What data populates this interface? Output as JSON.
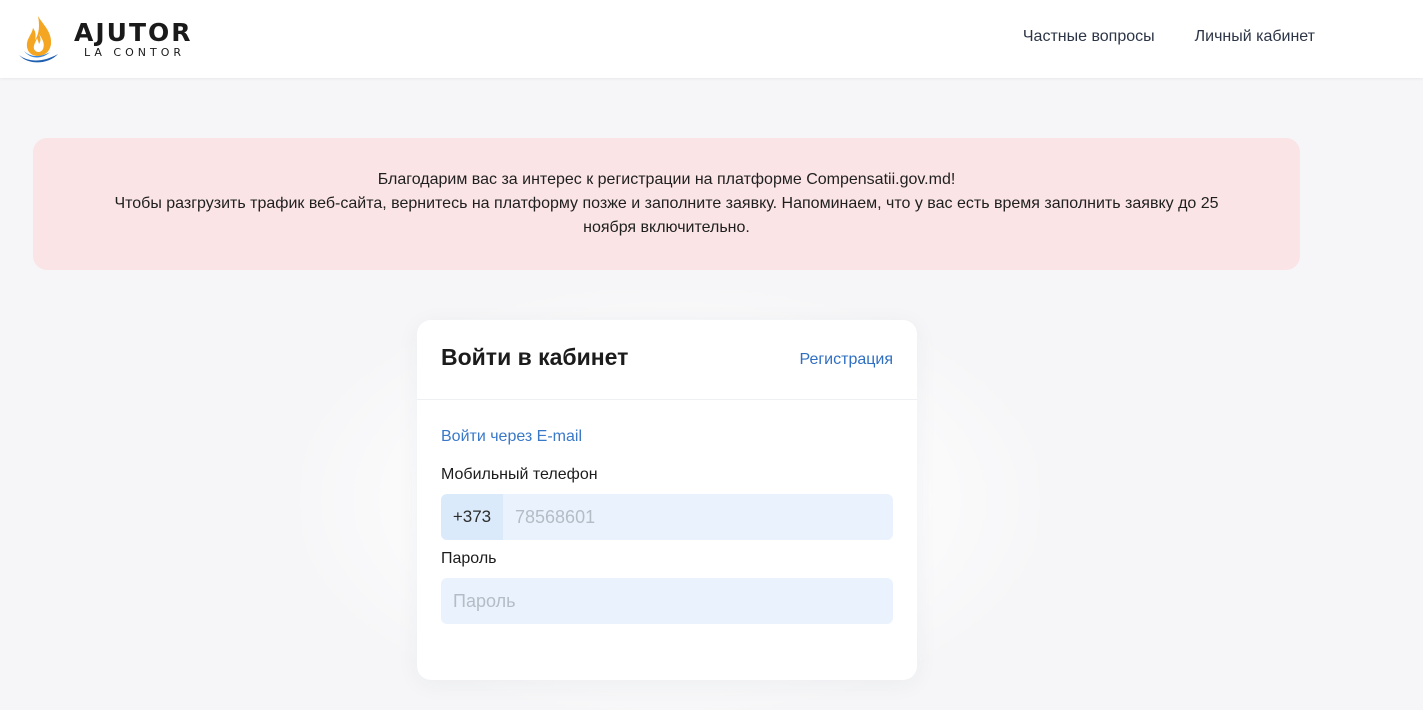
{
  "header": {
    "logo": {
      "main": "AJUTOR",
      "sub": "LA CONTOR"
    },
    "nav": [
      {
        "label": "Частные вопросы"
      },
      {
        "label": "Личный кабинет"
      }
    ]
  },
  "alert": {
    "line1": "Благодарим вас за интерес к регистрации на платформе Compensatii.gov.md!",
    "line2": "Чтобы разгрузить трафик веб-сайта, вернитесь на платформу позже и заполните заявку. Напоминаем, что у вас есть время заполнить заявку до 25 ноября включительно."
  },
  "login": {
    "title": "Войти в кабинет",
    "register_label": "Регистрация",
    "email_link": "Войти через E-mail",
    "phone_label": "Мобильный телефон",
    "phone_prefix": "+373",
    "phone_placeholder": "78568601",
    "password_label": "Пароль",
    "password_placeholder": "Пароль"
  },
  "colors": {
    "alert_bg": "#fae4e6",
    "link": "#2f6fc2",
    "input_bg": "#eaf3fd"
  }
}
